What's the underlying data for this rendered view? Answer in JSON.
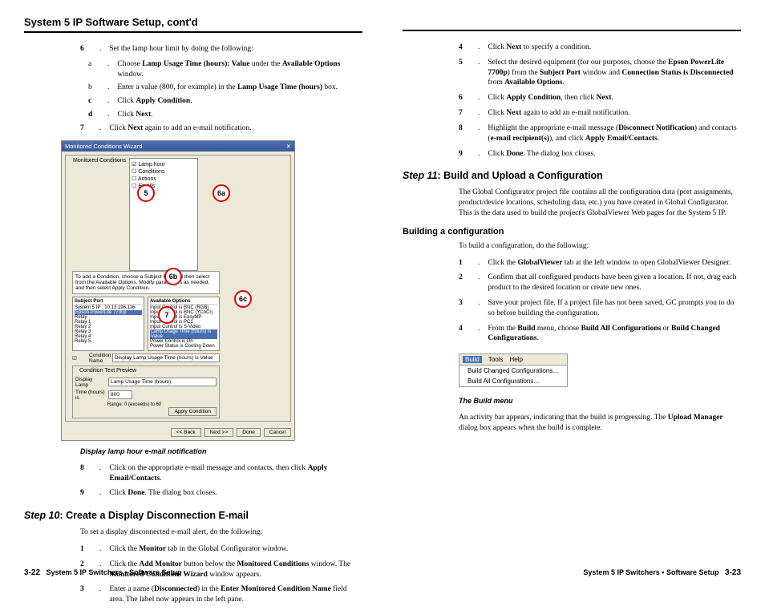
{
  "title": "System 5 IP Software Setup, cont'd",
  "l": {
    "i6": "Set the lamp hour limit by doing the following:",
    "a": "Choose <b>Lamp Usage Time (hours): Value</b> under the <b>Available Options</b> window.",
    "b": "Enter a value (800, for example) in the <b>Lamp Usage Time (hours)</b> box.",
    "c": "Click <b>Apply Condition</b>.",
    "d": "Click <b>Next</b>.",
    "i7": "Click <b>Next</b> again to add an e-mail notification.",
    "cap": "Display lamp hour e-mail notification",
    "i8": "Click on the appropriate e-mail message and contacts, then click <b>Apply Email/Contacts</b>.",
    "i9": "Click <b>Done</b>. The dialog box closes.",
    "step10": ": Create a Display Disconnection E-mail",
    "p10": "To set a display disconnected e-mail alert, do the following:",
    "s1": "Click the <b>Monitor</b> tab in the Global Configurator window.",
    "s2": "Click the <b>Add Monitor</b> button below the <b>Monitored Conditions</b> window. The <b>Monitored Conditions Wizard</b> window appears.",
    "s3": "Enter a name (<b>Disconnected</b>) in the <b>Enter Monitored Condition Name</b> field area. The label now appears in the left pane."
  },
  "r": {
    "i4": "Click <b>Next</b> to specify a condition.",
    "i5": "Select the desired equipment (for our purposes, choose the <b>Epson PowerLite 7700p</b>) from the <b>Subject Port</b> window and <b>Connection Status is Disconnected</b> from <b>Available Options</b>.",
    "i6": "Click <b>Apply Condition</b>, then click <b>Next</b>.",
    "i7": "Click <b>Next</b> again to add an e-mail notification.",
    "i8": "Highlight the appropriate e-mail message (<b>Disconnect Notification</b>) and contacts (<b>e-mail recipient(s)</b>), and click <b>Apply Email/Contacts</b>.",
    "i9": "Click <b>Done</b>. The dialog box closes.",
    "step11": ": Build and Upload a Configuration",
    "p11": "The Global Configurator project file contains all the configuration data (port assignments, product/device locations, scheduling data, etc.) you have created in Global Configurator. This is the data used to build the project's GlobalViewer Web pages for the System 5 IP.",
    "subhead": "Building a configuration",
    "pbuild": "To build a configuration, do the following:",
    "b1": "Click the <b>GlobalViewer</b> tab at the left window to open GlobalViewer Designer.",
    "b2": "Confirm that all configured products have been given a location. If not, drag each product to the desired location or create new ones.",
    "b3": "Save your project file. If a project file has not been saved, GC prompts you to do so before building the configuration.",
    "b4": "From the <b>Build</b> menu, choose <b>Build All Configurations</b> or <b>Build Changed Configurations</b>.",
    "capm": "The Build menu",
    "para2": "An activity bar appears, indicating that the build is progressing. The <b>Upload Manager</b> dialog box appears when the build is complete."
  },
  "fig": {
    "tbar": "Monitored Conditions Wizard",
    "grp": "Monitored Conditions",
    "tree": [
      "☑ Lamp hour",
      "☐ Conditions",
      "☐ Actions",
      "☐ Emails"
    ],
    "hint": "To add a Condition, choose a Subject Port and then select from the Available Options. Modify parameters as needed, and then select Apply Condition.",
    "sp": "Subject Port",
    "ao": "Available Options",
    "splist": [
      "System 5 IP : 10.13.196.116",
      "  Epson PowerLite 7700p",
      "Relay",
      "  Relay 1",
      "  Relay 2",
      "  Relay 3",
      "  Relay 4",
      "  Relay 5"
    ],
    "aolist": [
      "Input Control is BNC (RGB)",
      "Input Control is BNC (YCbCr)",
      "Input Control is EasyMP",
      "Input Control is PC1",
      "Input Control is S-Video",
      "Lamp Usage Time (hours) is Value",
      "Power Control is On",
      "Power Status is Cooling Down"
    ],
    "cn": "Condition Name",
    "cnv": "Display Lamp Usage Time (hours) is Value",
    "ctp": "Condition Text Preview",
    "dl": "Display Lamp",
    "lut": "Lamp Usage Time (hours)",
    "th": "Time (hours) is",
    "val": "800",
    "rng": "Range: 0 (exceeds) to 60",
    "btns": [
      "<< Back",
      "Next >>",
      "Done",
      "Cancel"
    ],
    "apply": "Apply Condition"
  },
  "menu": {
    "bar": [
      "Build",
      "Tools",
      "Help"
    ],
    "items": [
      "Build Changed Configurations…",
      "Build All Configurations…"
    ]
  },
  "footer": "System 5 IP Switchers • Software Setup",
  "pl": "3-22",
  "pr": "3-23"
}
